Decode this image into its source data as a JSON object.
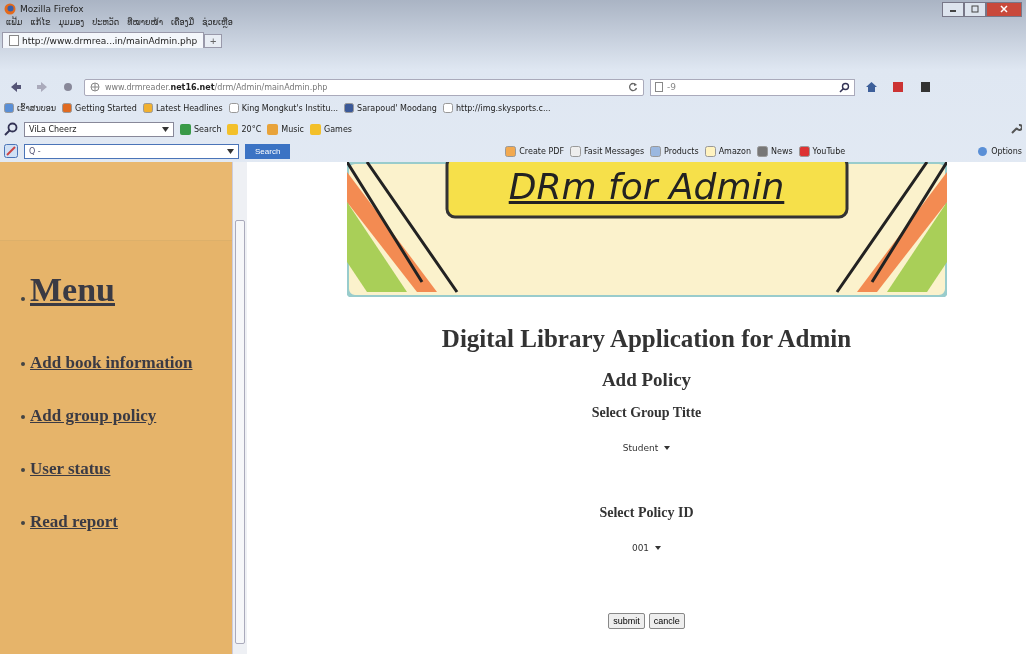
{
  "window": {
    "title": "Mozilla Firefox"
  },
  "menu_bar": [
    "ແຟ້ມ",
    "ແກ້ໄຂ",
    "ມຸມມອງ",
    "ປະຫວັດ",
    "ທີ່ໝາຍໜ້າ",
    "ເຄື່ອງມື",
    "ຊ່ວຍເຫຼືອ"
  ],
  "tabs": [
    {
      "label": "http://www.drmrea...in/mainAdmin.php",
      "selected": true
    }
  ],
  "new_tab": "+",
  "address_bar": {
    "prefix": "www.drmreader.",
    "domain": "net16.net",
    "path": "/drm/Admin/mainAdmin.php"
  },
  "search_box": {
    "placeholder": "-9"
  },
  "bookmarks": [
    "ເຂົ້າສນບອນ",
    "Getting Started",
    "Latest Headlines",
    "King Mongkut's Institu...",
    "Sarapoud' Moodang",
    "http://img.skysports.c..."
  ],
  "toolbar_1": {
    "field": "ViLa Cheerz",
    "items": [
      "Search",
      "20°C",
      "Music",
      "Games"
    ]
  },
  "toolbar_2": {
    "placeholder": "Q -",
    "search_button": "Search",
    "items": [
      "Create PDF",
      "Fasit Messages",
      "Products",
      "Amazon",
      "News",
      "YouTube"
    ],
    "options": "Options"
  },
  "banner": {
    "text": "DRm for Admin"
  },
  "sidebar": {
    "heading": "Menu",
    "items": [
      "Add book information",
      "Add group policy",
      "User status",
      "Read report"
    ]
  },
  "page": {
    "title": "Digital Library Application for Admin",
    "subtitle": "Add Policy",
    "fields": [
      {
        "label": "Select Group Titte",
        "value": "Student"
      },
      {
        "label": "Select Policy ID",
        "value": "001"
      }
    ],
    "buttons": [
      "submit",
      "cancle"
    ]
  }
}
